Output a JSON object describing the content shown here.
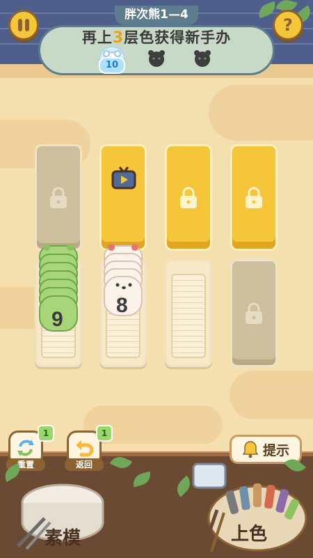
{
  "level": {
    "title": "胖次熊1—4"
  },
  "goal": {
    "prefix": "再上",
    "count": "3",
    "suffix": "层色获得新手办"
  },
  "rewards": {
    "first_count": "10"
  },
  "slots": {
    "tray1_count": "9",
    "tray2_count": "8"
  },
  "actions": {
    "reset_label": "重置",
    "reset_badge": "1",
    "undo_label": "返回",
    "undo_badge": "1",
    "hint_label": "提示",
    "mold_label": "素模",
    "paint_label": "上色"
  },
  "colors": {
    "accent": "#f6c63a",
    "green_bear": "#a8d47a",
    "white_bear": "#fbf2ea"
  },
  "icons": {
    "pause": "pause-icon",
    "help": "question-icon",
    "lock": "lock-icon",
    "tv": "tv-video-icon",
    "bell": "bell-icon"
  }
}
